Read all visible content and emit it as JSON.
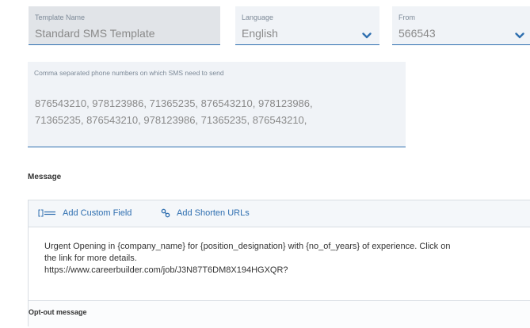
{
  "template": {
    "label": "Template Name",
    "value": "Standard SMS Template"
  },
  "language": {
    "label": "Language",
    "value": "English"
  },
  "from": {
    "label": "From",
    "value": "566543"
  },
  "phones": {
    "label": "Comma separated phone numbers on which SMS need to send",
    "line1": "876543210, 978123986, 71365235, 876543210, 978123986,",
    "line2": "71365235, 876543210, 978123986, 71365235, 876543210,"
  },
  "message": {
    "heading": "Message",
    "toolbar": {
      "custom_field": "Add Custom Field",
      "shorten_urls": "Add Shorten URLs"
    },
    "line1": "Urgent Opening in {company_name} for {position_designation} with {no_of_years} of experience. Click on",
    "line2": "the link for more details.",
    "line3": "https://www.careerbuilder.com/job/J3N87T6DM8X194HGXQR?"
  },
  "optout": {
    "label": "Opt-out message"
  },
  "colors": {
    "accent": "#2f6fb0",
    "field_bg": "#f0f3f7",
    "disabled_bg": "#e1e4e8"
  }
}
